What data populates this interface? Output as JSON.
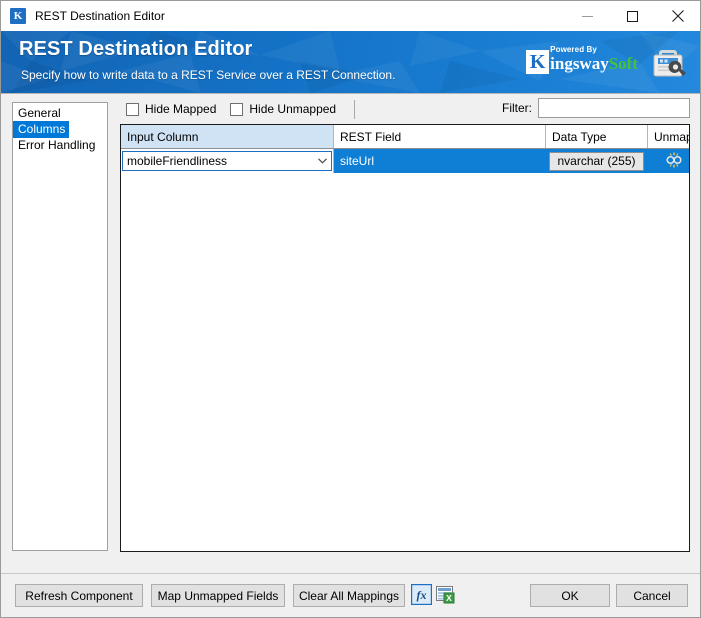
{
  "window": {
    "title": "REST Destination Editor",
    "app_icon": "kingswaysoft-k-icon",
    "controls": {
      "minimize": "minimize-icon",
      "maximize": "maximize-icon",
      "close": "close-icon"
    }
  },
  "banner": {
    "title": "REST Destination Editor",
    "subtitle": "Specify how to write data to a REST Service over a REST Connection.",
    "brand": {
      "mark": "K",
      "powered_by": "Powered By",
      "name_part1": "ingsway",
      "name_part2": "Soft"
    },
    "icon": "toolbox-wrench-icon",
    "accent_color": "#1472c6",
    "brand_green": "#48c13a"
  },
  "sidebar": {
    "items": [
      {
        "label": "General",
        "selected": false
      },
      {
        "label": "Columns",
        "selected": true
      },
      {
        "label": "Error Handling",
        "selected": false
      }
    ],
    "selected_color": "#0078d7"
  },
  "toolbar": {
    "hide_mapped": {
      "label": "Hide Mapped",
      "checked": false
    },
    "hide_unmapped": {
      "label": "Hide Unmapped",
      "checked": false
    },
    "filter_label": "Filter:",
    "filter_value": "",
    "filter_placeholder": ""
  },
  "grid": {
    "columns": [
      {
        "header": "Input Column",
        "active": true
      },
      {
        "header": "REST Field",
        "active": false
      },
      {
        "header": "Data Type",
        "active": false
      },
      {
        "header": "Unmap",
        "active": false
      }
    ],
    "rows": [
      {
        "input_column": "mobileFriendliness",
        "rest_field": "siteUrl",
        "data_type": "nvarchar (255)",
        "unmap_icon": "unmap-icon",
        "selected": true
      }
    ],
    "selection_color": "#0e7fd4"
  },
  "footer": {
    "refresh_label": "Refresh Component",
    "map_unmapped_label": "Map Unmapped Fields",
    "clear_all_label": "Clear All Mappings",
    "fx_icon": "formula-fx-icon",
    "export_icon": "export-spreadsheet-icon",
    "ok_label": "OK",
    "cancel_label": "Cancel"
  }
}
